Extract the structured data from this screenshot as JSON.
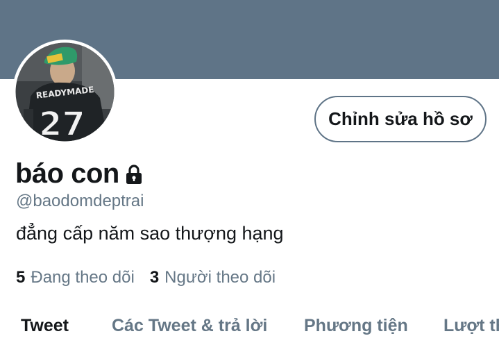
{
  "profile": {
    "banner_color": "#5f7487",
    "avatar_description_icon": "avatar-jersey-27",
    "display_name": "báo con",
    "handle": "@baodomdeptrai",
    "bio": "đẳng cấp năm sao thượng hạng",
    "protected_icon": "lock-icon",
    "edit_button_label": "Chỉnh sửa hồ sơ"
  },
  "stats": {
    "following_count": "5",
    "following_label": "Đang theo dõi",
    "followers_count": "3",
    "followers_label": "Người theo dõi"
  },
  "tabs": [
    {
      "label": "Tweet",
      "active": true
    },
    {
      "label": "Các Tweet & trả lời",
      "active": false
    },
    {
      "label": "Phương tiện",
      "active": false
    },
    {
      "label": "Lượt thích",
      "active": false
    }
  ]
}
